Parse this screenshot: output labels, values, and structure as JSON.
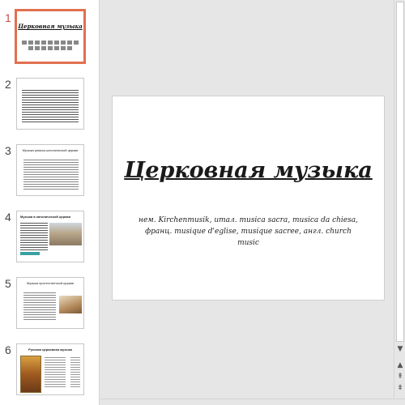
{
  "thumbnails": {
    "numbers": [
      "1",
      "2",
      "3",
      "4",
      "5",
      "6"
    ],
    "slide1_title": "Церковная музыка",
    "slide3_heading": "Музыка римско-католической церкви",
    "slide4_heading": "Музыка в католической церкви",
    "slide5_heading": "Музыка протестантской церкви",
    "slide6_heading": "Русская церковная музыка"
  },
  "slide": {
    "title": "Церковная музыка",
    "subtitle": "нем. Kirchenmusik, итал. musica sacra, musica da chiesa, франц. musique d'eglise, musique sacree, англ. church music"
  },
  "scrollbar": {
    "up_arrow": "▲",
    "down_arrow": "▼",
    "prev_slide": "⇞",
    "next_slide": "⇟"
  },
  "colors": {
    "accent": "#e07050",
    "active_number": "#c0504d",
    "background": "#e6e6e6"
  }
}
